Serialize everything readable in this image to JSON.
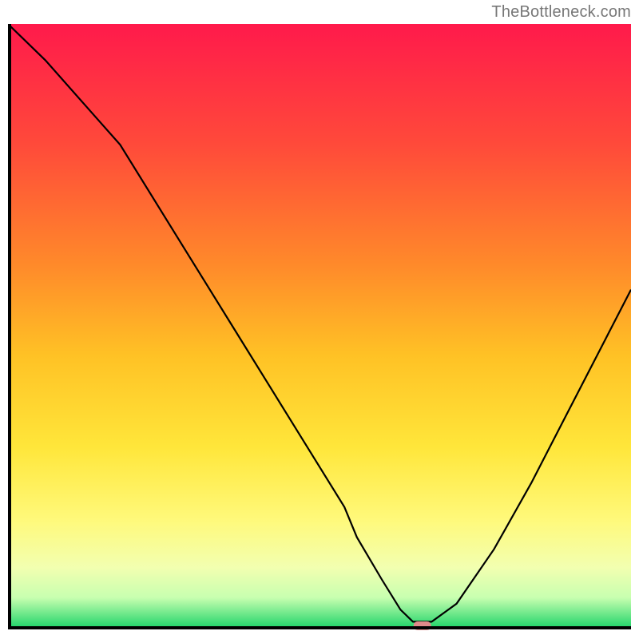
{
  "watermark": "TheBottleneck.com",
  "chart_data": {
    "type": "line",
    "title": "",
    "xlabel": "",
    "ylabel": "",
    "xlim": [
      0,
      100
    ],
    "ylim": [
      0,
      100
    ],
    "x": [
      0,
      6,
      12,
      18,
      24,
      30,
      36,
      42,
      48,
      54,
      56,
      60,
      63,
      65,
      68,
      72,
      78,
      84,
      90,
      96,
      100
    ],
    "values": [
      100,
      94,
      87,
      80,
      70,
      60,
      50,
      40,
      30,
      20,
      15,
      8,
      3,
      1,
      1,
      4,
      13,
      24,
      36,
      48,
      56
    ],
    "curve_color": "#000000",
    "marker": {
      "x": 66.5,
      "y": 0,
      "color": "#e08a8a"
    },
    "gradient_stops": [
      {
        "offset": 0.0,
        "color": "#ff1a4b"
      },
      {
        "offset": 0.2,
        "color": "#ff4a3a"
      },
      {
        "offset": 0.4,
        "color": "#ff8a2a"
      },
      {
        "offset": 0.55,
        "color": "#ffc225"
      },
      {
        "offset": 0.7,
        "color": "#ffe63a"
      },
      {
        "offset": 0.82,
        "color": "#fff97a"
      },
      {
        "offset": 0.9,
        "color": "#f2ffb0"
      },
      {
        "offset": 0.95,
        "color": "#c8ffb0"
      },
      {
        "offset": 1.0,
        "color": "#20d46a"
      }
    ],
    "axis_color": "#000000"
  }
}
